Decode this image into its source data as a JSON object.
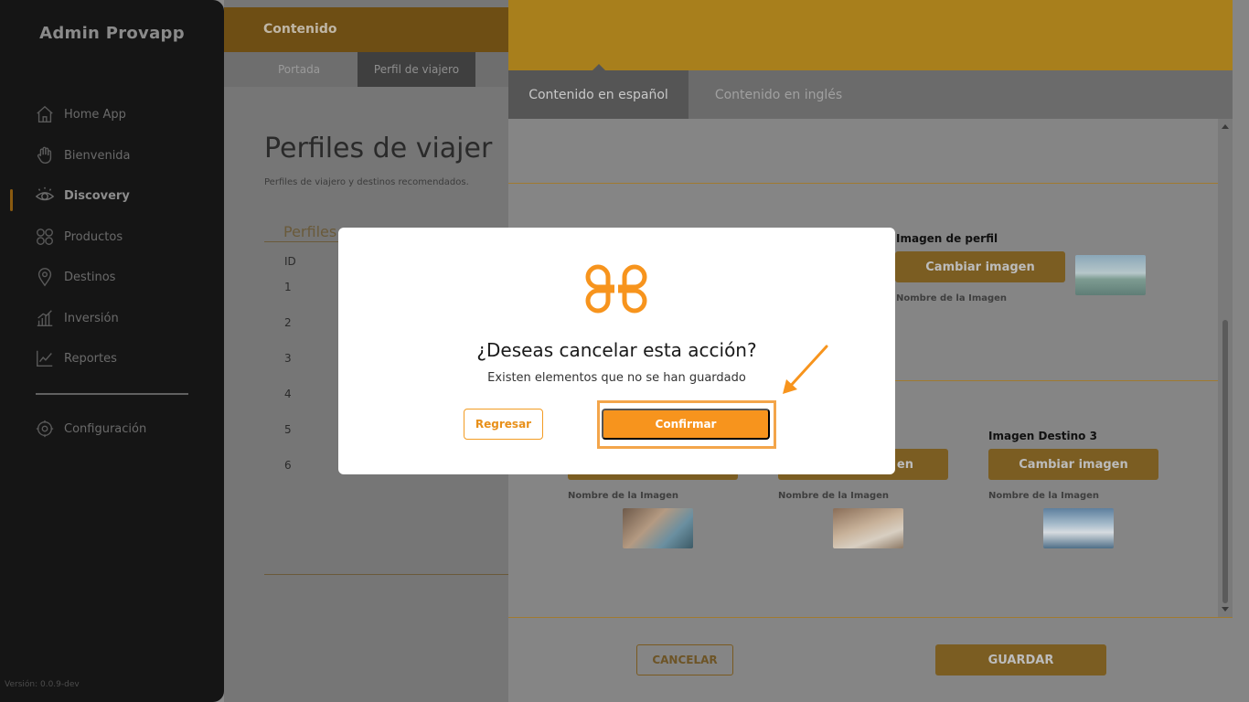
{
  "sidebar": {
    "brand": "Admin Provapp",
    "items": [
      {
        "label": "Home App",
        "icon": "home-icon"
      },
      {
        "label": "Bienvenida",
        "icon": "hand-wave-icon"
      },
      {
        "label": "Discovery",
        "icon": "eye-icon",
        "active": true
      },
      {
        "label": "Productos",
        "icon": "grid-icon"
      },
      {
        "label": "Destinos",
        "icon": "map-pin-icon"
      },
      {
        "label": "Inversión",
        "icon": "bar-chart-icon"
      },
      {
        "label": "Reportes",
        "icon": "line-chart-icon"
      }
    ],
    "settings": {
      "label": "Configuración",
      "icon": "gear-icon"
    },
    "version": "Versión: 0.0.9-dev"
  },
  "main": {
    "header_title": "Contenido",
    "subtabs": [
      "Portada",
      "Perfil de viajero"
    ],
    "active_subtab": "Perfil de viajero",
    "page_title": "Perfiles de viajer",
    "page_subtitle": "Perfiles de viajero y destinos recomendados.",
    "table_title": "Perfiles",
    "table_header": "ID",
    "table_ids": [
      "1",
      "2",
      "3",
      "4",
      "5",
      "6"
    ]
  },
  "panel": {
    "tabs": [
      "Contenido en español",
      "Contenido en inglés"
    ],
    "active_tab": "Contenido en español",
    "profile_image_label": "Imagen de perfil",
    "change_image_label": "Cambiar imagen",
    "image_name_label": "Nombre de la Imagen",
    "destino3_label": "Imagen Destino 3",
    "partial_button_text": "en",
    "cancel_label": "CANCELAR",
    "save_label": "GUARDAR"
  },
  "modal": {
    "logo_icon": "clover-logo-icon",
    "title": "¿Deseas cancelar esta acción?",
    "message": "Existen elementos que no se han guardado",
    "back_label": "Regresar",
    "confirm_label": "Confirmar"
  },
  "colors": {
    "accent": "#f7941d",
    "highlight": "#f3a54a",
    "overlay_header": "#a87f1c"
  }
}
